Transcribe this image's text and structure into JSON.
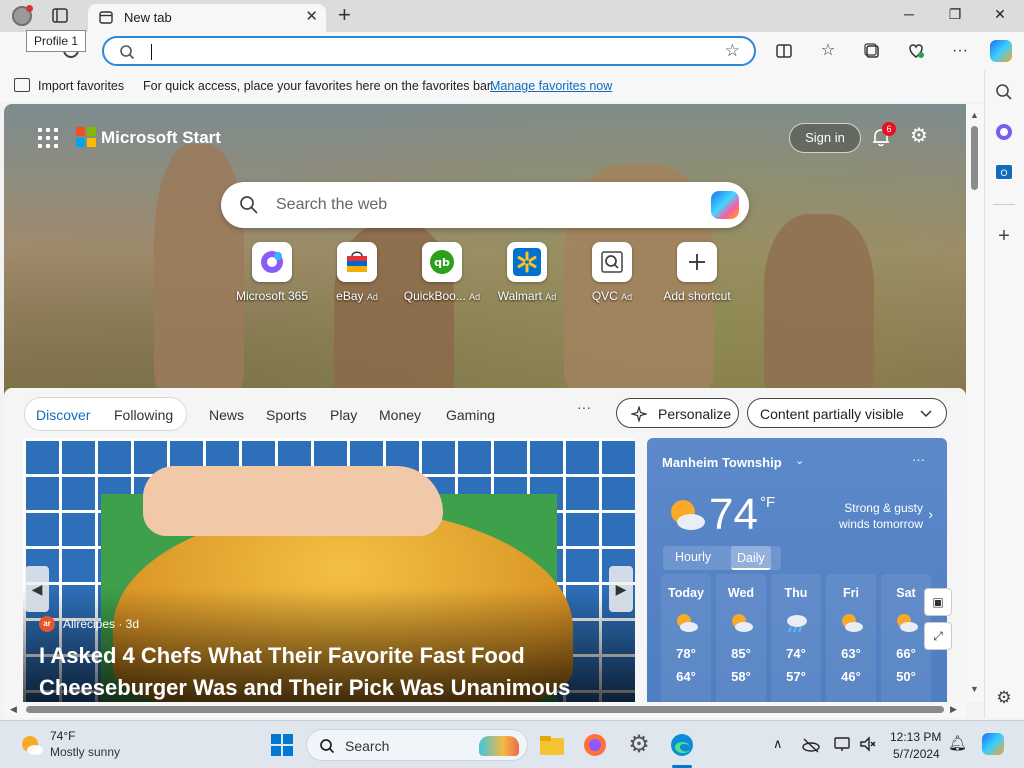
{
  "browser": {
    "tooltip": "Profile 1",
    "tab_title": "New tab",
    "tab_close": "✕",
    "new_tab": "+",
    "window_controls": {
      "minimize": "─",
      "restore": "❐",
      "close": "✕"
    }
  },
  "favorites_bar": {
    "import_label": "Import favorites",
    "hint": "For quick access, place your favorites here on the favorites bar.",
    "manage_link": "Manage favorites now"
  },
  "ms_start": {
    "brand": "Microsoft Start",
    "sign_in": "Sign in",
    "notification_count": "6",
    "search_placeholder": "Search the web",
    "shortcuts": [
      {
        "label": "Microsoft 365",
        "ad": ""
      },
      {
        "label": "eBay",
        "ad": "Ad"
      },
      {
        "label": "QuickBoo...",
        "ad": "Ad"
      },
      {
        "label": "Walmart",
        "ad": "Ad"
      },
      {
        "label": "QVC",
        "ad": "Ad"
      },
      {
        "label": "Add shortcut",
        "ad": ""
      }
    ]
  },
  "feed": {
    "tabs": [
      "Discover",
      "Following",
      "News",
      "Sports",
      "Play",
      "Money",
      "Gaming"
    ],
    "more": "···",
    "personalize": "Personalize",
    "content_visibility": "Content partially visible",
    "hero": {
      "source_logo": "ar",
      "source": "Allrecipes · 3d",
      "headline": "I Asked 4 Chefs What Their Favorite Fast Food Cheeseburger Was and Their Pick Was Unanimous"
    }
  },
  "weather": {
    "location": "Manheim Township",
    "temp": "74",
    "unit": "°F",
    "forecast": "Strong & gusty winds tomorrow",
    "tabs": [
      "Hourly",
      "Daily"
    ],
    "days": [
      {
        "name": "Today",
        "hi": "78°",
        "lo": "64°",
        "icon": "partly-sunny"
      },
      {
        "name": "Wed",
        "hi": "85°",
        "lo": "58°",
        "icon": "partly-sunny"
      },
      {
        "name": "Thu",
        "hi": "74°",
        "lo": "57°",
        "icon": "rain"
      },
      {
        "name": "Fri",
        "hi": "63°",
        "lo": "46°",
        "icon": "partly-sunny"
      },
      {
        "name": "Sat",
        "hi": "66°",
        "lo": "50°",
        "icon": "partly-sunny"
      }
    ]
  },
  "taskbar": {
    "temp": "74°F",
    "condition": "Mostly sunny",
    "search_label": "Search",
    "time": "12:13 PM",
    "date": "5/7/2024"
  },
  "colors": {
    "accent": "#0f6cbd",
    "address_border": "#2b88d8",
    "badge": "#e81123",
    "weather_panel": "#5b89c9"
  }
}
